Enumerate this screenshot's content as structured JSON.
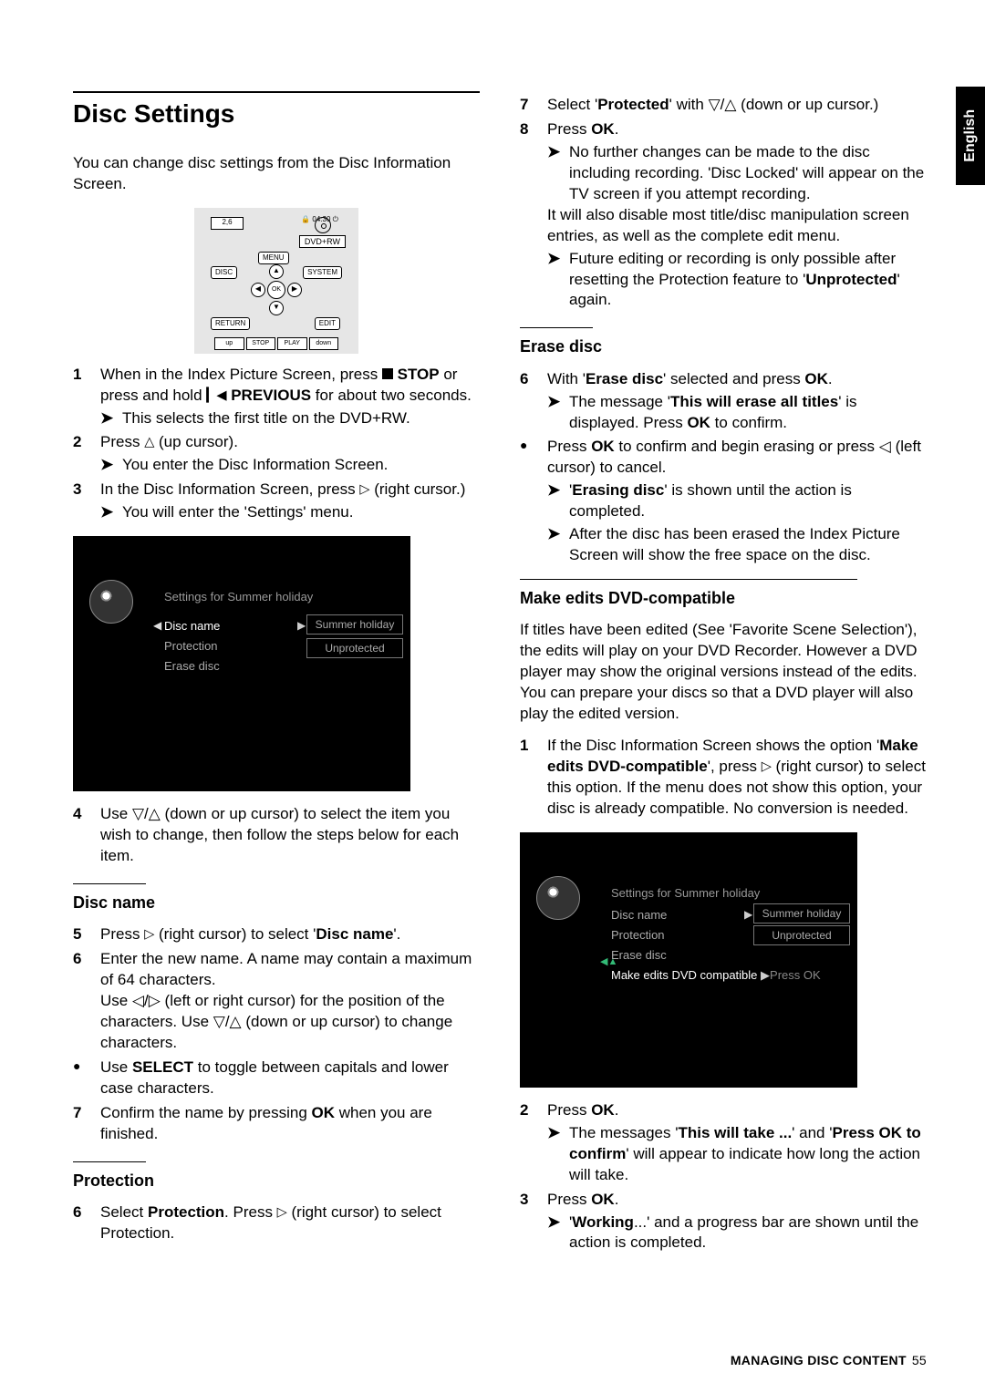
{
  "lang_tab": "English",
  "left": {
    "h1": "Disc Settings",
    "intro": "You can change disc settings from the Disc Information Screen.",
    "remote": {
      "lcd": "2,6",
      "time": "04:30",
      "dvdrw": "DVD+RW",
      "menu": "MENU",
      "disc": "DISC",
      "system": "SYSTEM",
      "return": "RETURN",
      "edit": "EDIT",
      "ok": "OK",
      "row": [
        "up",
        "STOP",
        "PLAY",
        "down"
      ]
    },
    "steps_a": {
      "s1_a": "When in the Index Picture Screen, press ",
      "s1_stop": "STOP",
      "s1_b": "or press and hold ",
      "s1_prev": "PREVIOUS",
      "s1_c": " for about two seconds.",
      "s1_sub": "This selects the first title on the DVD+RW.",
      "s2_a": "Press ",
      "s2_b": " (up cursor).",
      "s2_sub": "You enter the Disc Information Screen.",
      "s3_a": "In the Disc Information Screen, press ",
      "s3_b": " (right cursor.)",
      "s3_sub": "You will enter the 'Settings' menu."
    },
    "tv1": {
      "title": "Settings for Summer holiday",
      "items": [
        "Disc name",
        "Protection",
        "Erase disc"
      ],
      "val1": "Summer holiday",
      "val2": "Unprotected"
    },
    "s4": "Use ▽/△ (down or up cursor) to select the item you wish to change, then follow the steps below for each item.",
    "discname_h": "Disc name",
    "dn": {
      "s5_a": "Press ",
      "s5_b": " (right cursor) to select '",
      "s5_osd": "Disc name",
      "s5_c": "'.",
      "s6_a": "Enter the new name. A name may contain a maximum of 64 characters.",
      "s6_b": "Use ◁/▷ (left or right cursor) for the position of the characters. Use ▽/△ (down or up cursor) to change characters.",
      "bullet": "Use ",
      "bullet_b": "SELECT",
      "bullet_c": " to toggle between capitals and lower case characters.",
      "s7_a": "Confirm the name by pressing ",
      "s7_b": "OK",
      "s7_c": " when you are finished."
    },
    "prot_h": "Protection",
    "prot_s6_a": "Select ",
    "prot_osd": "Protection",
    "prot_s6_b": ". Press ",
    "prot_s6_c": " (right cursor) to select Protection."
  },
  "right": {
    "s7_a": "Select '",
    "s7_osd": "Protected",
    "s7_b": "' with ▽/△ (down or up cursor.)",
    "s8_a": "Press ",
    "s8_ok": "OK",
    "s8_c": ".",
    "s8_sub1": "No further changes can be made to the disc including recording. 'Disc Locked' will appear on the TV screen if you attempt recording.",
    "s8_line2": "It will also disable most title/disc manipulation screen entries, as well as the complete edit menu.",
    "s8_sub2a": "Future editing or recording is only possible after resetting the Protection feature to '",
    "s8_sub2_osd": "Unprotected",
    "s8_sub2b": "' again.",
    "erase_h": "Erase disc",
    "er": {
      "s6_a": "With '",
      "s6_osd": "Erase disc",
      "s6_b": "' selected and press ",
      "s6_ok": "OK",
      "s6_c": ".",
      "s6_sub_a": "The message '",
      "s6_sub_osd": "This will erase all titles",
      "s6_sub_b": "' is displayed. Press ",
      "s6_sub_ok": "OK",
      "s6_sub_c": " to confirm.",
      "bul_a": "Press ",
      "bul_ok": "OK",
      "bul_b": " to confirm and begin erasing or press ◁ (left cursor) to cancel.",
      "bul_sub_a": "'",
      "bul_sub_osd": "Erasing disc",
      "bul_sub_b": "' is shown until the action is completed.",
      "bul_sub2": "After the disc has been erased the Index Picture Screen will show the free space on the disc."
    },
    "make_h": "Make edits DVD-compatible",
    "make_intro": "If titles have been edited (See 'Favorite Scene Selection'), the edits will play on your DVD Recorder. However a DVD player may show the original versions instead of the edits. You can prepare your discs so that a DVD player will also play the edited version.",
    "mk": {
      "s1_a": "If the Disc Information Screen shows the option '",
      "s1_osd": "Make edits DVD-compatible",
      "s1_b": "', press ",
      "s1_c": " (right cursor) to select this option. If the menu does not show this option, your disc is already compatible. No conversion is needed."
    },
    "tv2": {
      "title": "Settings for Summer holiday",
      "items": [
        "Disc name",
        "Protection",
        "Erase disc",
        "Make edits DVD compatible"
      ],
      "val1": "Summer holiday",
      "val2": "Unprotected",
      "val4": "Press OK"
    },
    "mk2": {
      "s2_a": "Press ",
      "s2_ok": "OK",
      "s2_b": ".",
      "s2_sub_a": "The messages '",
      "s2_sub_osd1": "This will take ...",
      "s2_sub_mid": "' and '",
      "s2_sub_osd2": "Press OK to confirm",
      "s2_sub_b": "' will appear to indicate how long the action will take.",
      "s3_a": "Press ",
      "s3_ok": "OK",
      "s3_b": ".",
      "s3_sub_a": "'",
      "s3_sub_osd": "Working",
      "s3_sub_b": "...' and a progress bar are shown until the action is completed."
    }
  },
  "footer": {
    "label": "MANAGING DISC CONTENT",
    "page": "55"
  }
}
